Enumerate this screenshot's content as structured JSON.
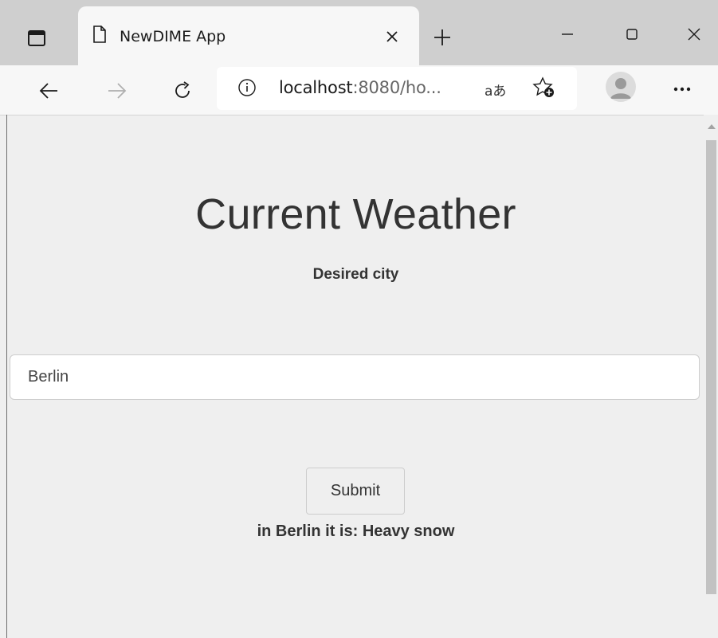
{
  "browser": {
    "tab": {
      "title": "NewDIME App"
    },
    "address_bar": {
      "host": "localhost",
      "rest": ":8080/ho..."
    },
    "read_aloud_glyph": "aあ",
    "more_glyph": "···"
  },
  "page": {
    "heading": "Current Weather",
    "city_label": "Desired city",
    "city_input": {
      "value": "Berlin",
      "placeholder": ""
    },
    "submit_label": "Submit",
    "result_text": "in Berlin it is: Heavy snow"
  },
  "colors": {
    "tabbar": "#cfcfcf",
    "toolbar": "#f7f7f7",
    "page_background": "#efefef",
    "text": "#333333"
  },
  "icons": [
    "tab-actions-icon",
    "page-icon",
    "close-icon",
    "new-tab-icon",
    "minimize-icon",
    "maximize-icon",
    "window-close-icon",
    "back-arrow-icon",
    "forward-arrow-icon",
    "refresh-icon",
    "info-icon",
    "favorites-add-icon",
    "profile-avatar-icon",
    "more-icon"
  ]
}
